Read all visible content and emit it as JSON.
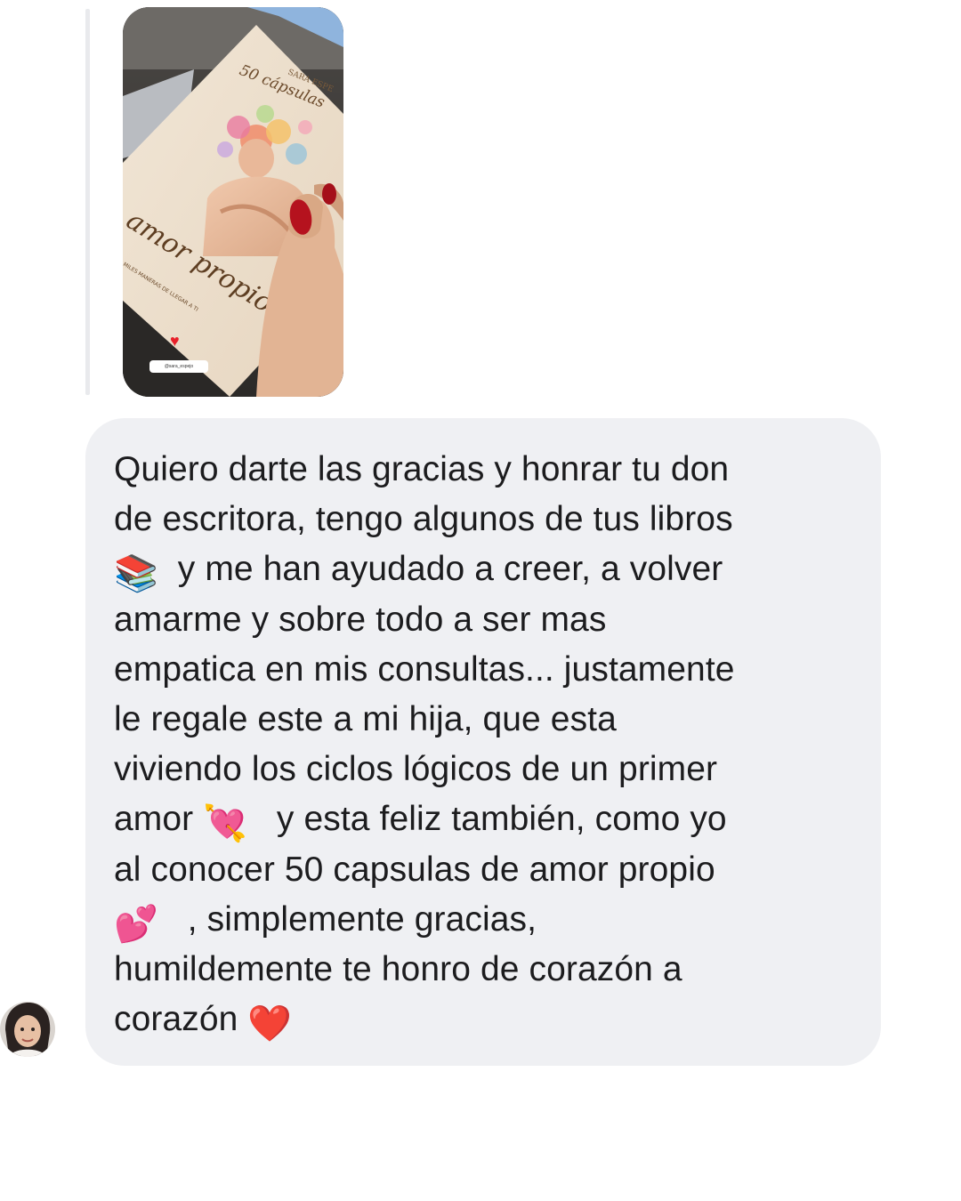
{
  "story": {
    "book_author": "SARA ESPE",
    "book_series": "50 cápsulas",
    "book_title": "amor propio",
    "book_subtitle": "MILES MANERAS DE LLEGAR A TI",
    "mention": "@sara_espejo"
  },
  "message": {
    "lines": [
      "Quiero darte las gracias y honrar tu don",
      "de escritora, tengo algunos de tus libros",
      "y me han ayudado a creer, a volver",
      "amarme y sobre todo a ser mas",
      "empatica en mis consultas... justamente",
      "le regale este a mi hija,  que esta",
      "viviendo los ciclos lógicos de un primer",
      "amor",
      "y esta feliz también,  como yo",
      "al conocer 50 capsulas de amor propio",
      ", simplemente gracias,",
      "humildemente te honro de corazón a",
      "corazón"
    ],
    "emojis": {
      "books": "📚",
      "heart_arrow": "💘",
      "two_hearts": "💕",
      "red_heart": "❤️"
    }
  },
  "colors": {
    "bubble_bg": "#eff0f3",
    "text": "#1c1c1e",
    "reply_line": "#e9eaed"
  },
  "icons": {
    "avatar": "sender-avatar"
  }
}
